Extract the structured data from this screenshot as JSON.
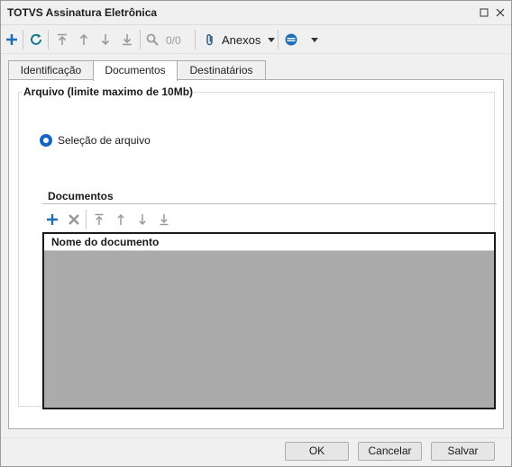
{
  "window": {
    "title": "TOTVS Assinatura Eletrônica"
  },
  "toolbar": {
    "counter": "0/0",
    "anexos_label": "Anexos",
    "icons": [
      "plus-icon",
      "refresh-icon",
      "move-first-icon",
      "move-up-icon",
      "move-down-icon",
      "move-last-icon",
      "search-icon",
      "paperclip-icon",
      "filter-icon"
    ]
  },
  "tabs": [
    {
      "label": "Identificação",
      "active": false
    },
    {
      "label": "Documentos",
      "active": true
    },
    {
      "label": "Destinatários",
      "active": false
    }
  ],
  "arquivo": {
    "group_title": "Arquivo (limite maximo de 10Mb)",
    "radio_label": "Seleção de arquivo"
  },
  "documentos": {
    "group_title": "Documentos",
    "column_header": "Nome do documento"
  },
  "footer": {
    "ok_label": "OK",
    "cancel_label": "Cancelar",
    "save_label": "Salvar"
  },
  "colors": {
    "accent_blue": "#1464c8",
    "grid_empty": "#ababab",
    "icon_teal": "#1a7a8c"
  }
}
